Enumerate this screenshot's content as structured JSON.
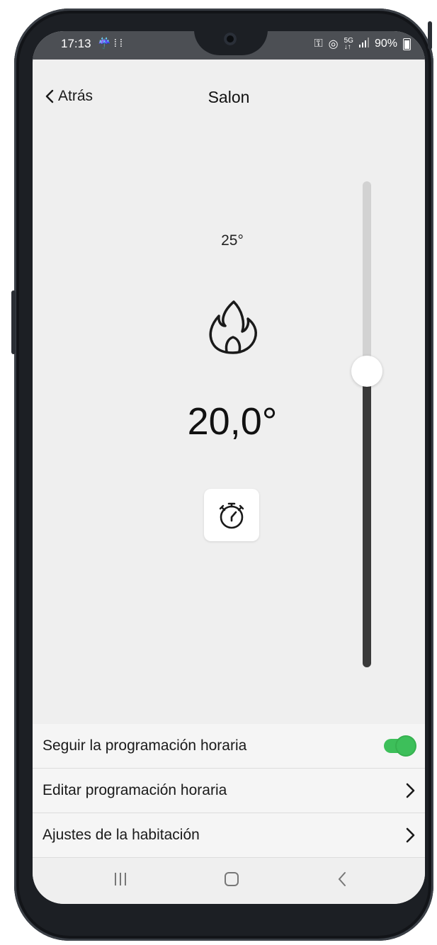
{
  "status_bar": {
    "time": "17:13",
    "left_icons": [
      "tuya-notification-icon",
      "app-grid-icon"
    ],
    "right_icons": [
      "vpn-key-icon",
      "hotspot-icon",
      "5g-icon",
      "signal-icon"
    ],
    "battery": "90%"
  },
  "nav": {
    "back_label": "Atrás",
    "title": "Salon"
  },
  "thermostat": {
    "setpoint": "25°",
    "current_temp": "20,0°",
    "mode_icon": "flame-icon",
    "timer_icon": "stopwatch-icon",
    "slider_level": 0.61
  },
  "settings": {
    "follow_schedule_label": "Seguir la programación horaria",
    "follow_schedule_on": true,
    "edit_schedule_label": "Editar programación horaria",
    "room_settings_label": "Ajustes de la habitación"
  },
  "colors": {
    "toggle_on": "#3dbf5a",
    "slider_fill": "#3a3a3a",
    "slider_track": "#d2d2d2",
    "background": "#efefef"
  },
  "system_nav": [
    "recent-apps-icon",
    "home-icon",
    "back-icon"
  ]
}
